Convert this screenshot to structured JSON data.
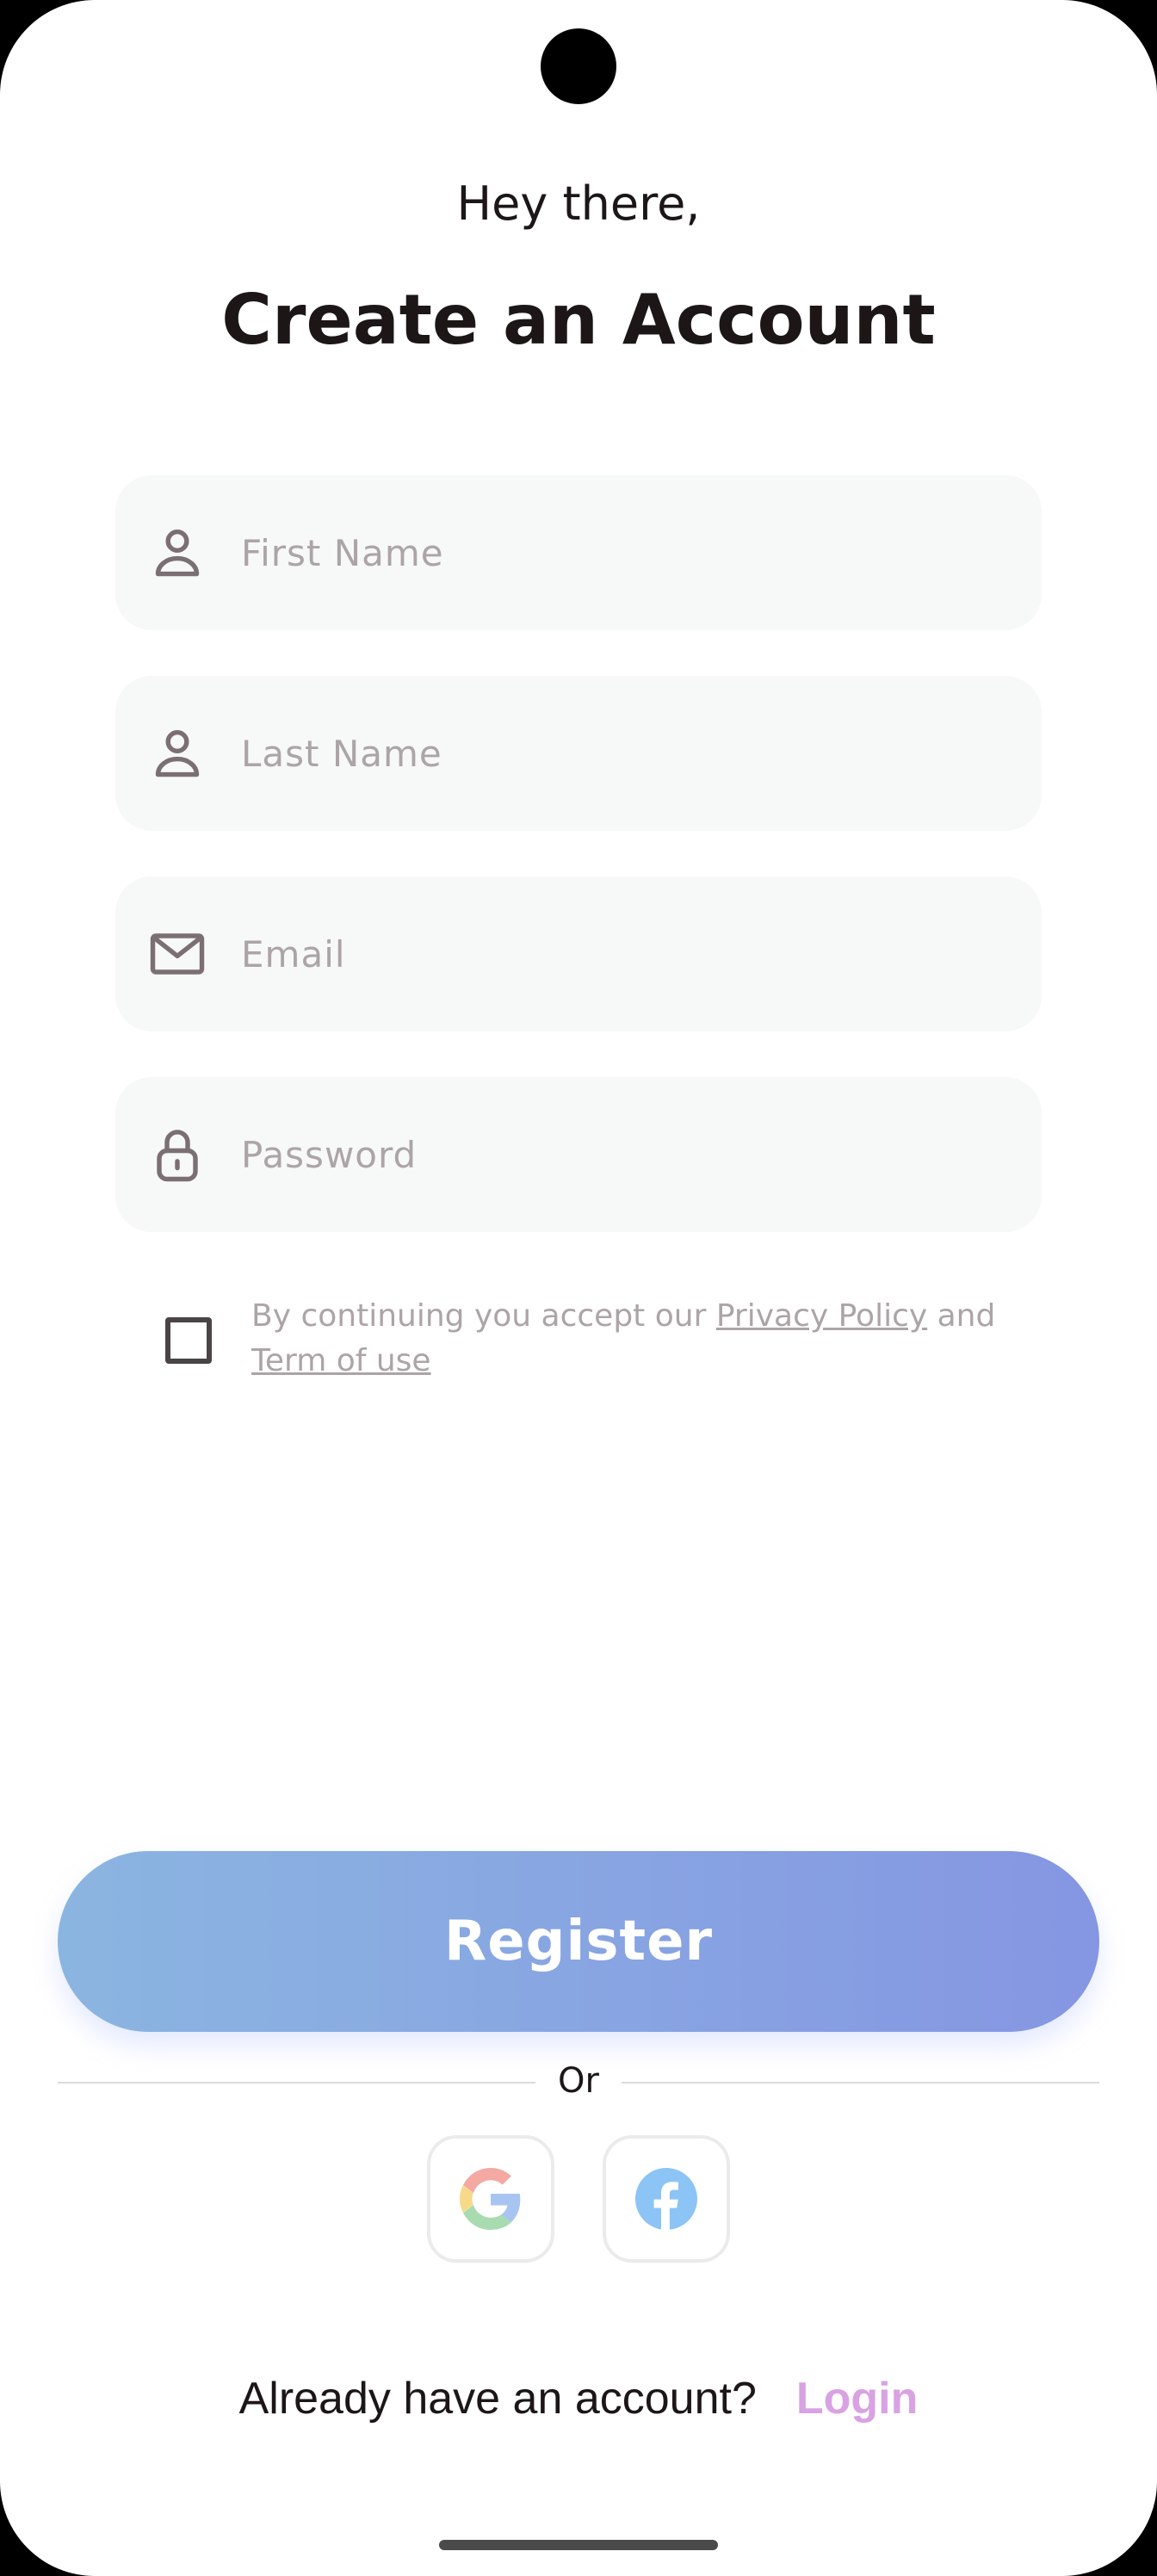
{
  "header": {
    "greeting": "Hey there,",
    "title": "Create an Account"
  },
  "form": {
    "first_name": {
      "placeholder": "First Name",
      "value": "",
      "icon": "user-icon"
    },
    "last_name": {
      "placeholder": "Last Name",
      "value": "",
      "icon": "user-icon"
    },
    "email": {
      "placeholder": "Email",
      "value": "",
      "icon": "mail-icon"
    },
    "password": {
      "placeholder": "Password",
      "value": "",
      "icon": "lock-icon"
    }
  },
  "terms": {
    "checked": false,
    "prefix": "By continuing you accept our ",
    "privacy_policy": "Privacy Policy",
    "conjunction": " and ",
    "term_of_use": "Term of use"
  },
  "actions": {
    "register_label": "Register",
    "divider_label": "Or",
    "social": [
      {
        "name": "google",
        "icon": "google-icon"
      },
      {
        "name": "facebook",
        "icon": "facebook-icon"
      }
    ]
  },
  "footer": {
    "prompt": "Already have an account?",
    "login_label": "Login"
  },
  "colors": {
    "text_primary": "#1d1617",
    "placeholder": "#ada4a5",
    "field_bg": "#f7f8f8",
    "gradient_start": "#8bb5e1",
    "gradient_end": "#8596e2",
    "login_link": "#d9a2e3"
  }
}
